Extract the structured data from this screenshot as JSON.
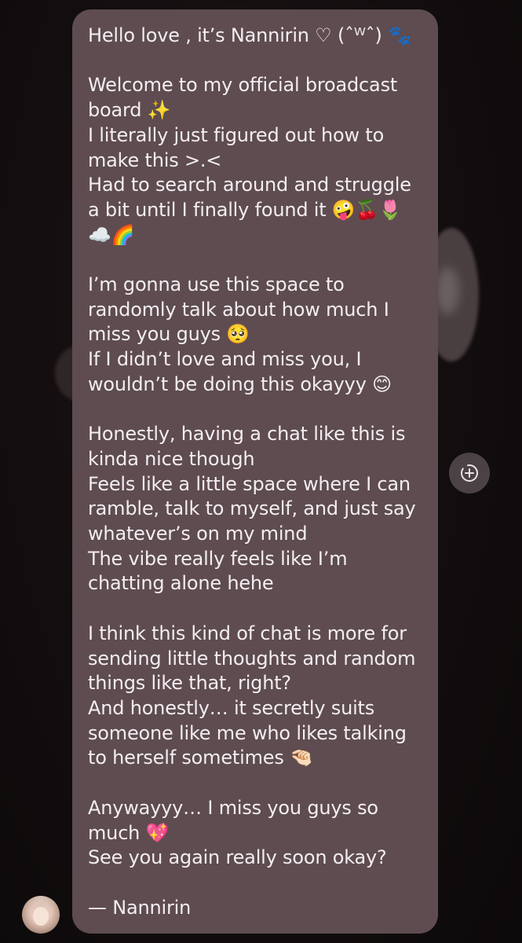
{
  "message": {
    "text": "Hello love , it’s Nannirin ♡ (ˆᵂˆ) 🐾\n\nWelcome to my official broadcast board ✨\nI literally just figured out how to make this >.<\nHad to search around and struggle a bit until I finally found it 🤪🍒🌷☁️🌈\n\nI’m gonna use this space to randomly talk about how much I miss you guys 🥺\nIf I didn’t love and miss you, I wouldn’t be doing this okayyy 😊\n\nHonestly, having a chat like this is kinda nice though\nFeels like a little space where I can ramble, talk to myself, and just say whatever’s on my mind\nThe vibe really feels like I’m chatting alone hehe\n\nI think this kind of chat is more for sending little thoughts and random things like that, right?\nAnd honestly… it secretly suits someone like me who likes talking to herself sometimes 🤏🏻\n\nAnywayyy… I miss you guys so much 💖\nSee you again really soon okay?\n\n— Nannirin"
  },
  "icons": {
    "forward": "add-reaction-icon",
    "avatar": "sender-avatar"
  },
  "colors": {
    "background": "#100c0d",
    "bubble": "#5e4c50",
    "text": "#f3eef0",
    "forward_button": "#4a4244"
  }
}
